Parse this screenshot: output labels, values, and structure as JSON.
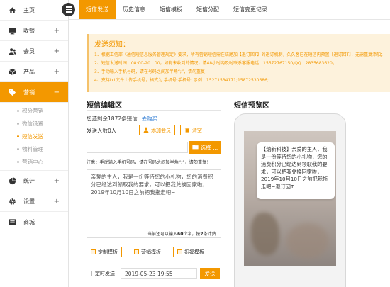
{
  "sidebar": {
    "items": [
      {
        "label": "主页",
        "icon": "home-icon",
        "plus": false
      },
      {
        "label": "收银",
        "icon": "monitor-icon",
        "plus": true
      },
      {
        "label": "会员",
        "icon": "users-icon",
        "plus": true
      },
      {
        "label": "产品",
        "icon": "cube-icon",
        "plus": true
      },
      {
        "label": "营销",
        "icon": "tag-icon",
        "plus": false,
        "active": true
      }
    ],
    "sub_items": [
      {
        "label": "积分营销"
      },
      {
        "label": "微信设置"
      },
      {
        "label": "短信发送",
        "active": true
      },
      {
        "label": "物料管理"
      },
      {
        "label": "营销中心"
      }
    ],
    "bottom_items": [
      {
        "label": "统计",
        "icon": "pie-chart-icon",
        "plus": true
      },
      {
        "label": "设置",
        "icon": "gear-icon",
        "plus": true
      },
      {
        "label": "商城",
        "icon": "shop-icon",
        "plus": false
      }
    ],
    "plus_symbol": "+",
    "minus_symbol": "−"
  },
  "tabs": [
    "短信发送",
    "历史信息",
    "短信模板",
    "短信分配",
    "短信变更记录"
  ],
  "notice": {
    "title": "发送须知：",
    "lines": [
      "1、根据工信部《通信短信息服务管理规定》要求，所有营销短信需在结尾加【退订回T】的退订机制，久久客已在短信内预置【退订回T】，无需重复添加；",
      "2、短信发送时间：08:00-20：00，如有未收到的情况，请48小时内及时联系客服电话：15572767150/QQ：2835683620；",
      "3、手动输入手机号码，请在号码之间加半角“;”，请勿重复；",
      "4、支持txt文件上传手机号，格式为 手机号;手机号; 示例：15271534171;15872530686;"
    ]
  },
  "editor": {
    "title": "短信编辑区",
    "balance": "您还剩余1872条短信",
    "buy_link": "去购买",
    "recipients": "发送人数0人",
    "add_member": "添加会员",
    "clear": "清空",
    "phone_placeholder": "",
    "select_button": "选择 ...",
    "note": "注意：手动输入手机号码，请在号码之间加半角“;”，请勿重复！",
    "message": "亲爱的主人，我是一份等待您的小礼物，您的消费积分已经达到领取我的要求，可以把我兑换回家啦，2019年10月10日之前把我拖走吧~",
    "counter_prefix": "当前还可以输入",
    "counter_count": "60",
    "counter_mid": "个字，按",
    "counter_sms": "2",
    "counter_suffix": "条计费",
    "tpl_custom": "定制模板",
    "tpl_marketing": "营销模板",
    "tpl_greeting": "祝福模板",
    "timer_label": "定时发送",
    "datetime": "2019-05-23 19:55",
    "send": "发送"
  },
  "preview": {
    "title": "短信预览区",
    "text": "【纳新科技】亲爱的主人，我是一份等待您的小礼物，您的消费积分已经达到领取我的要求，可以把我兑换回家啦，2019年10月10日之前把我拖走吧~退订回T"
  },
  "colors": {
    "accent": "#f39800",
    "link": "#2e7bd3",
    "notice_bg": "#fdf2dc"
  }
}
